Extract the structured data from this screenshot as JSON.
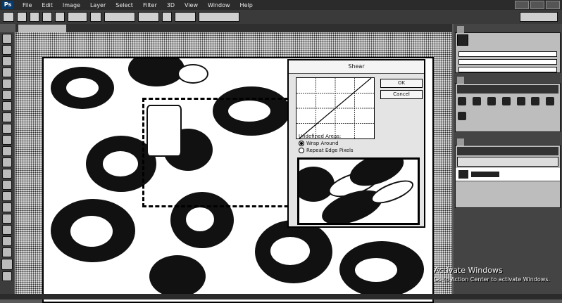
{
  "menubar": {
    "items": [
      "File",
      "Edit",
      "Image",
      "Layer",
      "Select",
      "Filter",
      "3D",
      "View",
      "Window",
      "Help"
    ]
  },
  "dialog": {
    "title": "Shear",
    "ok_label": "OK",
    "cancel_label": "Cancel",
    "undefined_areas_label": "Undefined Areas:",
    "options": [
      {
        "label": "Wrap Around",
        "selected": true
      },
      {
        "label": "Repeat Edge Pixels",
        "selected": false
      }
    ]
  },
  "watermark": {
    "title": "Activate Windows",
    "subtitle": "Go to Action Center to activate Windows."
  }
}
